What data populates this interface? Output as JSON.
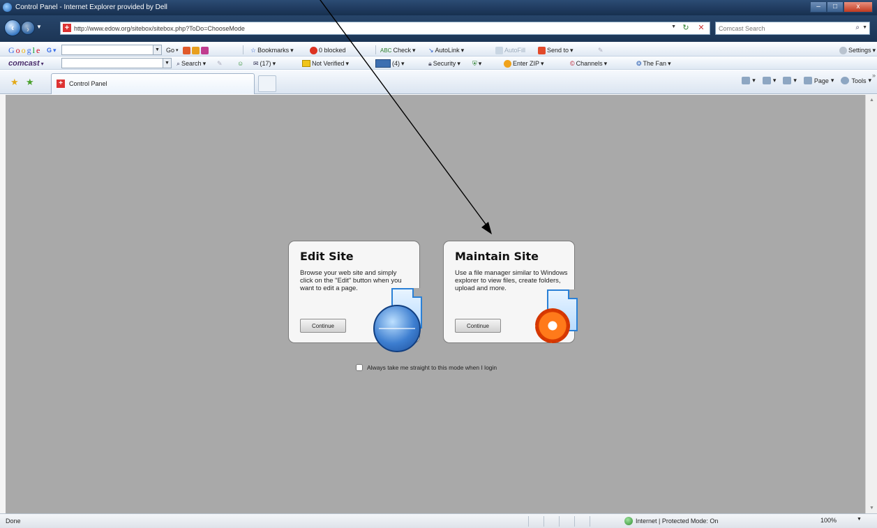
{
  "window": {
    "title": "Control Panel - Internet Explorer provided by Dell",
    "min_label": "–",
    "max_label": "□",
    "close_label": "x"
  },
  "address": {
    "url": "http://www.edow.org/sitebox/sitebox.php?ToDo=ChooseMode",
    "search_placeholder": "Comcast Search"
  },
  "google_toolbar": {
    "logo": [
      "G",
      "o",
      "o",
      "g",
      "l",
      "e"
    ],
    "search_logo": "G",
    "go_label": "Go",
    "bookmarks_label": "Bookmarks",
    "blocked_label": "0 blocked",
    "check_label": "Check",
    "autolink_label": "AutoLink",
    "autofill_label": "AutoFill",
    "sendto_label": "Send to",
    "settings_label": "Settings"
  },
  "comcast_toolbar": {
    "logo": "comcast",
    "search_label": "Search",
    "mail_label": "(17)",
    "notverified_label": "Not Verified",
    "inbox_label": "(4)",
    "security_label": "Security",
    "zip_label": "Enter ZIP",
    "channels_label": "Channels",
    "thefan_label": "The Fan"
  },
  "tabs": {
    "active_label": "Control Panel",
    "page_label": "Page",
    "tools_label": "Tools"
  },
  "cards": [
    {
      "title": "Edit Site",
      "description": "Browse your web site and simply click on the \"Edit\" button when you want to edit a page.",
      "button": "Continue",
      "icon": "globe-document-icon"
    },
    {
      "title": "Maintain Site",
      "description": "Use a file manager similar to Windows explorer to view files, create folders, upload and more.",
      "button": "Continue",
      "icon": "gear-document-icon"
    }
  ],
  "always_mode_label": "Always take me straight to this mode when I login",
  "status": {
    "text": "Done",
    "zone": "Internet | Protected Mode: On",
    "zoom": "100%"
  },
  "colors": {
    "content_bg": "#a9a9a9",
    "titlebar": "#1f3a5e",
    "card_bg": "#f6f6f6",
    "annotation_arrow": "#000000"
  }
}
